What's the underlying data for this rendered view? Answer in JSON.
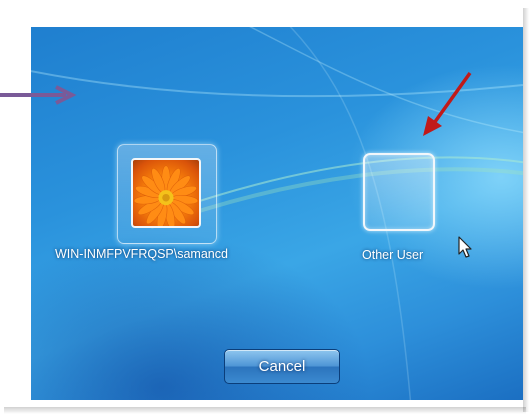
{
  "login_screen": {
    "users": [
      {
        "label": "WIN-INMFPVFRQSP\\samancd",
        "picture": "orange-daisy-flower"
      },
      {
        "label": "Other User",
        "picture": "blank"
      }
    ],
    "cancel_label": "Cancel"
  },
  "annotations": {
    "left_arrow_color": "#7a5a98",
    "right_arrow_color": "#c01a1a"
  },
  "icons": {
    "pointer": "mouse-cursor-icon"
  }
}
